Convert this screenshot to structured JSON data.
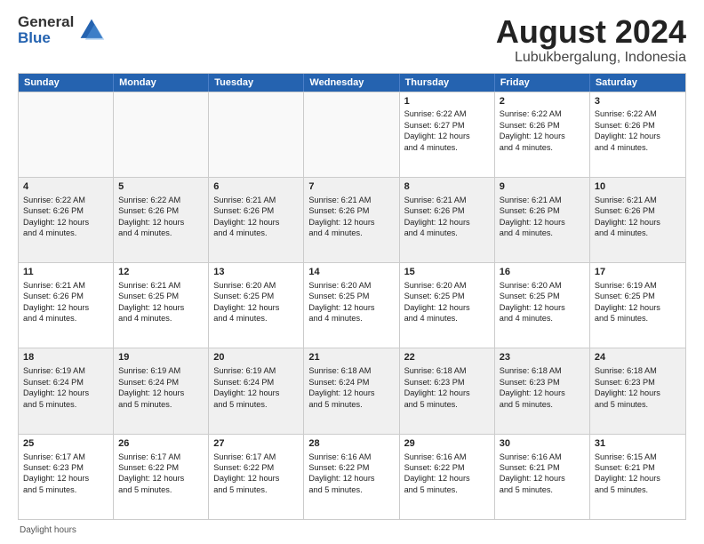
{
  "logo": {
    "line1": "General",
    "line2": "Blue"
  },
  "title": "August 2024",
  "subtitle": "Lubukbergalung, Indonesia",
  "footer": "Daylight hours",
  "header_days": [
    "Sunday",
    "Monday",
    "Tuesday",
    "Wednesday",
    "Thursday",
    "Friday",
    "Saturday"
  ],
  "weeks": [
    [
      {
        "day": "",
        "info": ""
      },
      {
        "day": "",
        "info": ""
      },
      {
        "day": "",
        "info": ""
      },
      {
        "day": "",
        "info": ""
      },
      {
        "day": "1",
        "info": "Sunrise: 6:22 AM\nSunset: 6:27 PM\nDaylight: 12 hours\nand 4 minutes."
      },
      {
        "day": "2",
        "info": "Sunrise: 6:22 AM\nSunset: 6:26 PM\nDaylight: 12 hours\nand 4 minutes."
      },
      {
        "day": "3",
        "info": "Sunrise: 6:22 AM\nSunset: 6:26 PM\nDaylight: 12 hours\nand 4 minutes."
      }
    ],
    [
      {
        "day": "4",
        "info": "Sunrise: 6:22 AM\nSunset: 6:26 PM\nDaylight: 12 hours\nand 4 minutes."
      },
      {
        "day": "5",
        "info": "Sunrise: 6:22 AM\nSunset: 6:26 PM\nDaylight: 12 hours\nand 4 minutes."
      },
      {
        "day": "6",
        "info": "Sunrise: 6:21 AM\nSunset: 6:26 PM\nDaylight: 12 hours\nand 4 minutes."
      },
      {
        "day": "7",
        "info": "Sunrise: 6:21 AM\nSunset: 6:26 PM\nDaylight: 12 hours\nand 4 minutes."
      },
      {
        "day": "8",
        "info": "Sunrise: 6:21 AM\nSunset: 6:26 PM\nDaylight: 12 hours\nand 4 minutes."
      },
      {
        "day": "9",
        "info": "Sunrise: 6:21 AM\nSunset: 6:26 PM\nDaylight: 12 hours\nand 4 minutes."
      },
      {
        "day": "10",
        "info": "Sunrise: 6:21 AM\nSunset: 6:26 PM\nDaylight: 12 hours\nand 4 minutes."
      }
    ],
    [
      {
        "day": "11",
        "info": "Sunrise: 6:21 AM\nSunset: 6:26 PM\nDaylight: 12 hours\nand 4 minutes."
      },
      {
        "day": "12",
        "info": "Sunrise: 6:21 AM\nSunset: 6:25 PM\nDaylight: 12 hours\nand 4 minutes."
      },
      {
        "day": "13",
        "info": "Sunrise: 6:20 AM\nSunset: 6:25 PM\nDaylight: 12 hours\nand 4 minutes."
      },
      {
        "day": "14",
        "info": "Sunrise: 6:20 AM\nSunset: 6:25 PM\nDaylight: 12 hours\nand 4 minutes."
      },
      {
        "day": "15",
        "info": "Sunrise: 6:20 AM\nSunset: 6:25 PM\nDaylight: 12 hours\nand 4 minutes."
      },
      {
        "day": "16",
        "info": "Sunrise: 6:20 AM\nSunset: 6:25 PM\nDaylight: 12 hours\nand 4 minutes."
      },
      {
        "day": "17",
        "info": "Sunrise: 6:19 AM\nSunset: 6:25 PM\nDaylight: 12 hours\nand 5 minutes."
      }
    ],
    [
      {
        "day": "18",
        "info": "Sunrise: 6:19 AM\nSunset: 6:24 PM\nDaylight: 12 hours\nand 5 minutes."
      },
      {
        "day": "19",
        "info": "Sunrise: 6:19 AM\nSunset: 6:24 PM\nDaylight: 12 hours\nand 5 minutes."
      },
      {
        "day": "20",
        "info": "Sunrise: 6:19 AM\nSunset: 6:24 PM\nDaylight: 12 hours\nand 5 minutes."
      },
      {
        "day": "21",
        "info": "Sunrise: 6:18 AM\nSunset: 6:24 PM\nDaylight: 12 hours\nand 5 minutes."
      },
      {
        "day": "22",
        "info": "Sunrise: 6:18 AM\nSunset: 6:23 PM\nDaylight: 12 hours\nand 5 minutes."
      },
      {
        "day": "23",
        "info": "Sunrise: 6:18 AM\nSunset: 6:23 PM\nDaylight: 12 hours\nand 5 minutes."
      },
      {
        "day": "24",
        "info": "Sunrise: 6:18 AM\nSunset: 6:23 PM\nDaylight: 12 hours\nand 5 minutes."
      }
    ],
    [
      {
        "day": "25",
        "info": "Sunrise: 6:17 AM\nSunset: 6:23 PM\nDaylight: 12 hours\nand 5 minutes."
      },
      {
        "day": "26",
        "info": "Sunrise: 6:17 AM\nSunset: 6:22 PM\nDaylight: 12 hours\nand 5 minutes."
      },
      {
        "day": "27",
        "info": "Sunrise: 6:17 AM\nSunset: 6:22 PM\nDaylight: 12 hours\nand 5 minutes."
      },
      {
        "day": "28",
        "info": "Sunrise: 6:16 AM\nSunset: 6:22 PM\nDaylight: 12 hours\nand 5 minutes."
      },
      {
        "day": "29",
        "info": "Sunrise: 6:16 AM\nSunset: 6:22 PM\nDaylight: 12 hours\nand 5 minutes."
      },
      {
        "day": "30",
        "info": "Sunrise: 6:16 AM\nSunset: 6:21 PM\nDaylight: 12 hours\nand 5 minutes."
      },
      {
        "day": "31",
        "info": "Sunrise: 6:15 AM\nSunset: 6:21 PM\nDaylight: 12 hours\nand 5 minutes."
      }
    ]
  ]
}
